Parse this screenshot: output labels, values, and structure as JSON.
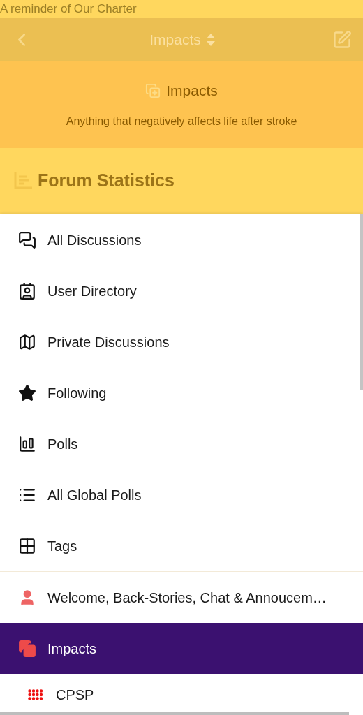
{
  "notice": "A reminder of Our Charter",
  "nav_bar": {
    "title": "Impacts"
  },
  "banner": {
    "title": "Impacts",
    "subtitle": "Anything that negatively affects life after stroke"
  },
  "stats": {
    "title": "Forum Statistics"
  },
  "menu": {
    "items": [
      {
        "label": "All Discussions"
      },
      {
        "label": "User Directory"
      },
      {
        "label": "Private Discussions"
      },
      {
        "label": "Following"
      },
      {
        "label": "Polls"
      },
      {
        "label": "All Global Polls"
      },
      {
        "label": "Tags"
      }
    ],
    "categories": [
      {
        "label": "Welcome, Back-Stories, Chat & Annoucem…",
        "selected": false
      },
      {
        "label": "Impacts",
        "selected": true,
        "children": [
          {
            "label": "CPSP",
            "selected": false
          }
        ]
      }
    ]
  }
}
